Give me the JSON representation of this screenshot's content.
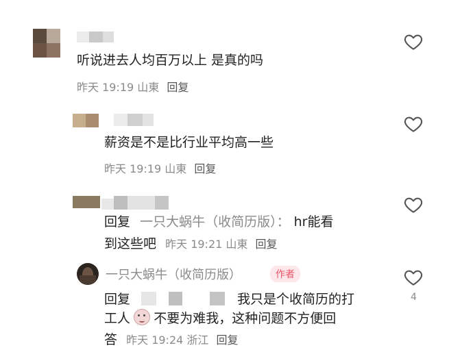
{
  "comments": [
    {
      "text": "听说进去人均百万以上 是真的吗",
      "time": "昨天 19:19",
      "location": "山東",
      "reply_label": "回复"
    },
    {
      "text": "薪资是不是比行业平均高一些",
      "time": "昨天 19:19",
      "location": "山東",
      "reply_label": "回复"
    },
    {
      "prefix": "回复",
      "target": "一只大蜗牛（收简历版）：",
      "text_line1": "hr能看",
      "text_line2": "到这些吧",
      "time": "昨天 19:21",
      "location": "山東",
      "reply_label": "回复"
    },
    {
      "name": "一只大蜗牛（收简历版）",
      "badge": "作者",
      "prefix": "回复",
      "line1": "我只是个收简历的打",
      "line2a": "工人",
      "line2b": "不要为难我，这种问题不方便回",
      "line3": "答",
      "time": "昨天 19:24",
      "location": "浙江",
      "reply_label": "回复",
      "like_count": "4"
    }
  ],
  "colors": {
    "meta": "#8a8a8a",
    "badge_bg": "#fde7ea",
    "badge_text": "#e8566c"
  }
}
